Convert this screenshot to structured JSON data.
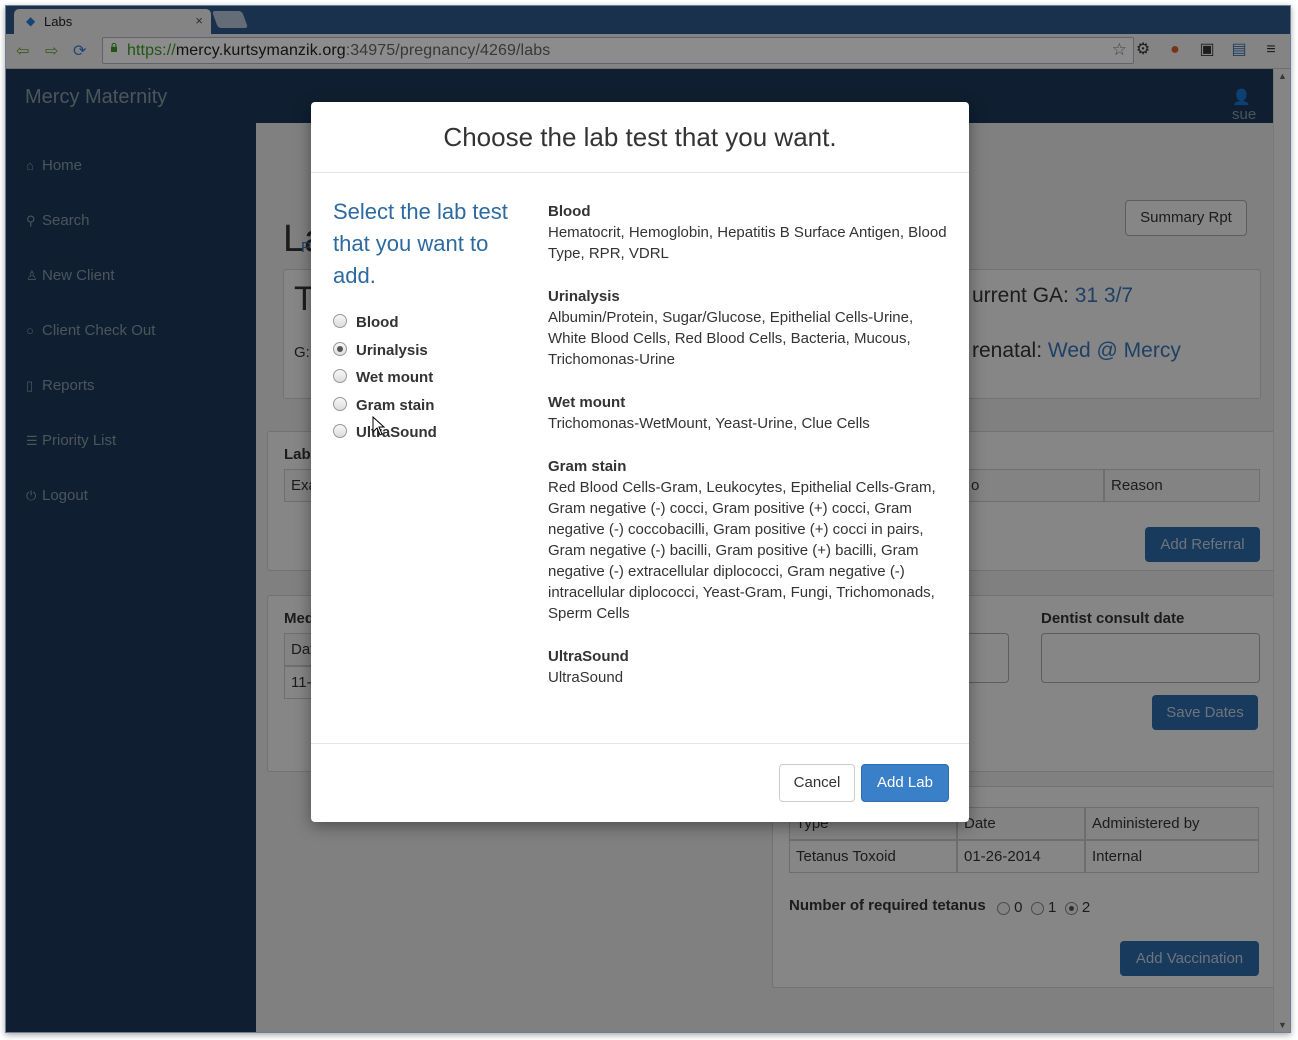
{
  "browser": {
    "tab_title": "Labs",
    "tab_close": "×",
    "url_scheme": "https://",
    "url_host": "mercy.kurtsymanzik.org",
    "url_rest": ":34975/pregnancy/4269/labs"
  },
  "app": {
    "brand": "Mercy Maternity",
    "user": "sue",
    "sidebar": [
      {
        "label": "Home",
        "icon": "home-icon"
      },
      {
        "label": "Search",
        "icon": "search-icon"
      },
      {
        "label": "New Client",
        "icon": "user-icon"
      },
      {
        "label": "Client Check Out",
        "icon": "circle-icon"
      },
      {
        "label": "Reports",
        "icon": "file-icon"
      },
      {
        "label": "Priority List",
        "icon": "list-icon"
      },
      {
        "label": "Logout",
        "icon": "power-icon"
      }
    ]
  },
  "background": {
    "page_title": "La",
    "summary_btn": "Summary Rpt",
    "tab_initial": "P",
    "client_initial": "T",
    "g_label": "G:",
    "current_ga_label": "urrent GA:",
    "current_ga_value": "31 3/7",
    "prenatal_label": "renatal:",
    "prenatal_value": "Wed @ Mercy",
    "labs_label": "Lab",
    "exam_col": "Exa",
    "to_col": "o",
    "reason_col": "Reason",
    "add_referral": "Add Referral",
    "med_label": "Med",
    "date_col": "Dat",
    "date_val": "11-",
    "dentist_label": "Dentist consult date",
    "save_dates": "Save Dates",
    "vacc_type_col": "Type",
    "vacc_date_col": "Date",
    "vacc_admin_col": "Administered by",
    "vacc_type": "Tetanus Toxoid",
    "vacc_date": "01-26-2014",
    "vacc_admin": "Internal",
    "tetanus_label": "Number of required tetanus",
    "tetanus_options": [
      "0",
      "1",
      "2"
    ],
    "tetanus_selected": "2",
    "add_vaccination": "Add Vaccination"
  },
  "modal": {
    "title": "Choose the lab test that you want.",
    "prompt": "Select the lab test that you want to add.",
    "options": [
      "Blood",
      "Urinalysis",
      "Wet mount",
      "Gram stain",
      "UltraSound"
    ],
    "selected": "Urinalysis",
    "descriptions": [
      {
        "heading": "Blood",
        "text": "Hematocrit, Hemoglobin, Hepatitis B Surface Antigen, Blood Type, RPR, VDRL"
      },
      {
        "heading": "Urinalysis",
        "text": "Albumin/Protein, Sugar/Glucose, Epithelial Cells-Urine, White Blood Cells, Red Blood Cells, Bacteria, Mucous, Trichomonas-Urine"
      },
      {
        "heading": "Wet mount",
        "text": "Trichomonas-WetMount, Yeast-Urine, Clue Cells"
      },
      {
        "heading": "Gram stain",
        "text": "Red Blood Cells-Gram, Leukocytes, Epithelial Cells-Gram, Gram negative (-) cocci, Gram positive (+) cocci, Gram negative (-) coccobacilli, Gram positive (+) cocci in pairs, Gram negative (-) bacilli, Gram positive (+) bacilli, Gram negative (-) extracellular diplococci, Gram negative (-) intracellular diplococci, Yeast-Gram, Fungi, Trichomonads, Sperm Cells"
      },
      {
        "heading": "UltraSound",
        "text": "UltraSound"
      }
    ],
    "cancel": "Cancel",
    "add": "Add Lab"
  }
}
